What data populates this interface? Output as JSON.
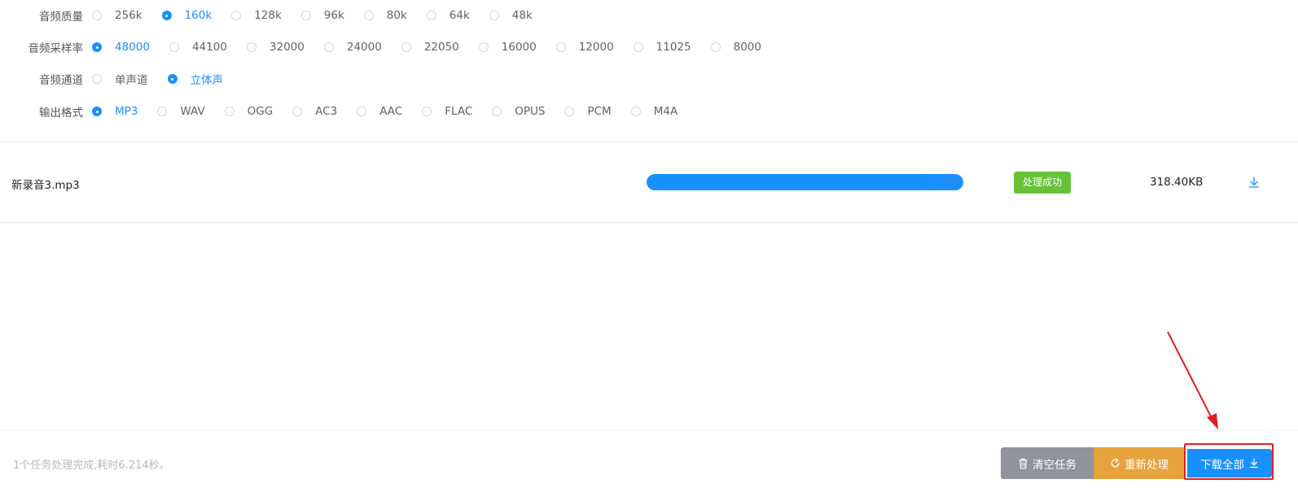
{
  "settings": {
    "quality": {
      "label": "音频质量",
      "options": [
        "256k",
        "160k",
        "128k",
        "96k",
        "80k",
        "64k",
        "48k"
      ],
      "selected": "160k"
    },
    "sample_rate": {
      "label": "音频采样率",
      "options": [
        "48000",
        "44100",
        "32000",
        "24000",
        "22050",
        "16000",
        "12000",
        "11025",
        "8000"
      ],
      "selected": "48000"
    },
    "channel": {
      "label": "音频通道",
      "options": [
        "单声道",
        "立体声"
      ],
      "selected": "立体声"
    },
    "format": {
      "label": "输出格式",
      "options": [
        "MP3",
        "WAV",
        "OGG",
        "AC3",
        "AAC",
        "FLAC",
        "OPUS",
        "PCM",
        "M4A"
      ],
      "selected": "MP3"
    }
  },
  "file": {
    "name": "新录音3.mp3",
    "progress_percent": 100,
    "progress_text": "100%",
    "status": "处理成功",
    "size": "318.40KB",
    "download_icon": "download-icon"
  },
  "footer": {
    "summary": "1个任务处理完成,耗时6.214秒。",
    "clear_label": "清空任务",
    "clear_icon": "trash-icon",
    "redo_label": "重新处理",
    "redo_icon": "refresh-icon",
    "download_all_label": "下载全部",
    "download_all_icon": "download-icon"
  },
  "colors": {
    "primary": "#1890ff",
    "success": "#67c23a",
    "warning": "#e6a23c",
    "neutral": "#909399",
    "annotation": "#e02020"
  }
}
